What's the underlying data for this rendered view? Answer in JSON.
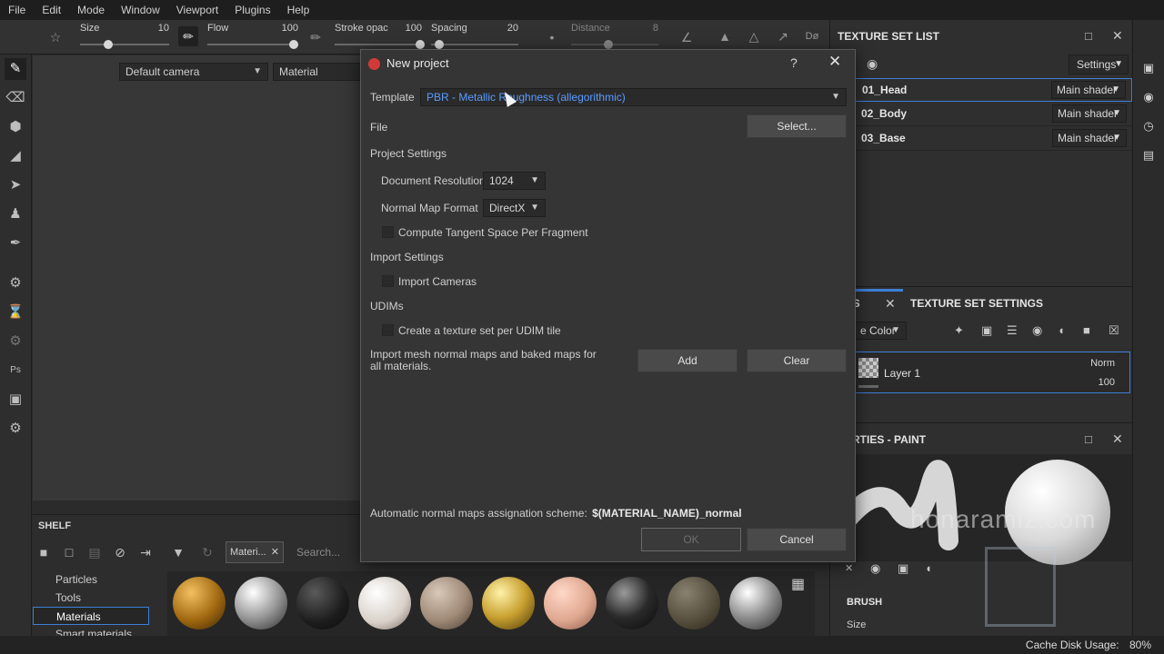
{
  "menu": [
    "File",
    "Edit",
    "Mode",
    "Window",
    "Viewport",
    "Plugins",
    "Help"
  ],
  "toolbar": {
    "size_label": "Size",
    "size_value": "10",
    "flow_label": "Flow",
    "flow_value": "100",
    "stroke_label": "Stroke opac",
    "stroke_value": "100",
    "spacing_label": "Spacing",
    "spacing_value": "20",
    "distance_label": "Distance",
    "distance_value": "8",
    "sym_label": "Dø"
  },
  "viewport": {
    "camera": "Default camera",
    "mode": "Material"
  },
  "shelf": {
    "title": "SHELF",
    "tab_label": "Materi...",
    "search_placeholder": "Search...",
    "categories": [
      "Particles",
      "Tools",
      "Materials",
      "Smart materials"
    ],
    "selected_category": "Materials"
  },
  "texture_set_list": {
    "title": "TEXTURE SET LIST",
    "settings_label": "Settings",
    "rows": [
      {
        "name": "01_Head",
        "shader": "Main shader"
      },
      {
        "name": "02_Body",
        "shader": "Main shader"
      },
      {
        "name": "03_Base",
        "shader": "Main shader"
      }
    ]
  },
  "layers": {
    "tab_layers": "ERS",
    "tab_settings": "TEXTURE SET SETTINGS",
    "channel": "e Color",
    "layer_name": "Layer 1",
    "blend": "Norm",
    "opacity": "100"
  },
  "properties": {
    "title": "PERTIES - PAINT",
    "brush_label": "BRUSH",
    "size_label": "Size"
  },
  "watermark": "honaramiz.com",
  "status": {
    "cache": "Cache Disk Usage:",
    "cache_value": "80%"
  },
  "dialog": {
    "title": "New project",
    "help": "?",
    "template_label": "Template",
    "template_value": "PBR - Metallic Roughness (allegorithmic)",
    "file_label": "File",
    "select_button": "Select...",
    "project_settings": "Project Settings",
    "doc_res_label": "Document Resolution",
    "doc_res_value": "1024",
    "normal_map_label": "Normal Map Format",
    "normal_map_value": "DirectX",
    "tangent_label": "Compute Tangent Space Per Fragment",
    "import_settings": "Import Settings",
    "import_cameras": "Import Cameras",
    "udims": "UDIMs",
    "udim_option": "Create a texture set per UDIM tile",
    "import_maps_text": "Import mesh normal maps and baked maps for all materials.",
    "add_button": "Add",
    "clear_button": "Clear",
    "scheme_label": "Automatic normal maps assignation scheme:",
    "scheme_value": "$(MATERIAL_NAME)_normal",
    "ok_button": "OK",
    "cancel_button": "Cancel"
  },
  "colors": {
    "accent": "#3d7fd6",
    "template_text": "#5a9cff",
    "dialog_bg": "#353535"
  }
}
